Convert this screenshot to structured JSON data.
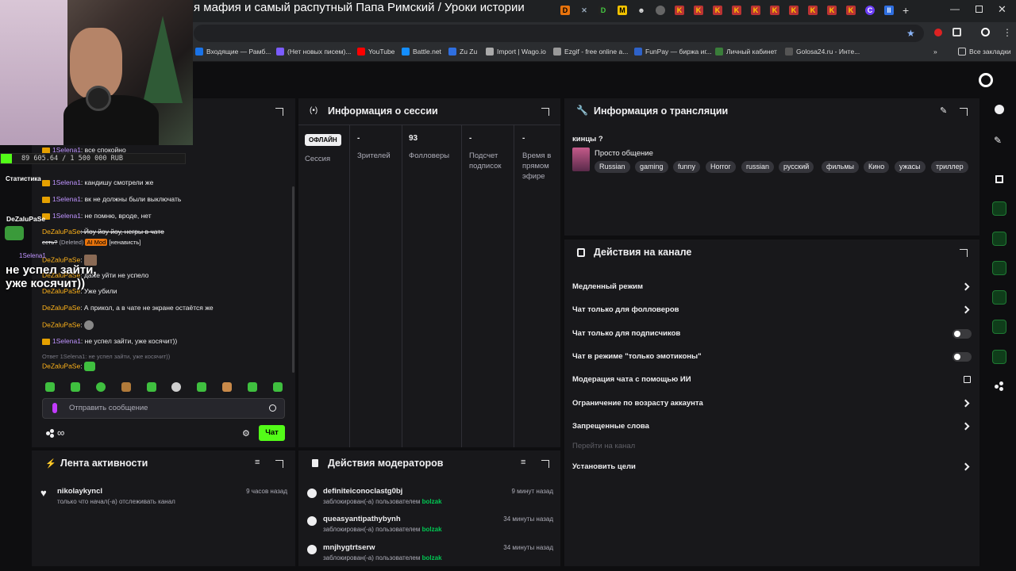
{
  "browser": {
    "tab_title": "я мафия и самый распутный Папа Римский / Уроки истории",
    "bookmarks": [
      "Входящие — Рамб...",
      "(Нет новых писем)...",
      "YouTube",
      "Battle.net",
      "Zu Zu",
      "Import | Wago.io",
      "Ezgif - free online a...",
      "FunPay — биржа иг...",
      "Личный кабинет",
      "Golosa24.ru - Инте..."
    ],
    "all_bookmarks": "Все закладки",
    "more": "»"
  },
  "overlay": {
    "donation": "89 605.64 / 1 500 000 RUB",
    "stats_label": "Статистика",
    "overlay_user": "DeZaluPaSe",
    "overlay_user2": "1Selena1",
    "overlay_msg": "не успел зайти, уже косячит))"
  },
  "chat": {
    "lines": [
      {
        "user": "1Selena1",
        "text": ": все спокойно",
        "cls": "u1"
      },
      {
        "user": "1Selena1",
        "text": ": кандишу смотрели же",
        "cls": "u1"
      },
      {
        "user": "1Selena1",
        "text": ": вк не должны были выключать",
        "cls": "u1"
      },
      {
        "user": "1Selena1",
        "text": ": не помню, вроде, нет",
        "cls": "u1"
      }
    ],
    "deleted_user": "DeZaluPaSe",
    "deleted_text": ": Йоу йоу йоу, негры в чате",
    "deleted_text2": "есть?",
    "deleted_tag": "(Deleted)",
    "ai_mod": "AI Mod",
    "ai_reason": "[ненависть]",
    "lines2": [
      {
        "user": "DeZaluPaSe",
        "text": ":"
      },
      {
        "user": "DeZaluPaSe",
        "text": ": даже уйти не успело"
      },
      {
        "user": "DeZaluPaSe",
        "text": ": Уже убили"
      },
      {
        "user": "DeZaluPaSe",
        "text": ": А прикол, а в чате не экране остаётся же"
      },
      {
        "user": "DeZaluPaSe",
        "text": ":"
      }
    ],
    "last_user": "1Selena1",
    "last_text": ": не успел зайти, уже косячит))",
    "reply_hint": "Ответ 1Selena1: не успел зайти, уже косячит))",
    "reply_user": "DeZaluPaSe",
    "reply_text": ":",
    "input_placeholder": "Отправить сообщение",
    "send_label": "Чат",
    "points": "∞"
  },
  "session": {
    "title": "Информация о сессии",
    "status_badge": "ОФЛАЙН",
    "session_label": "Сессия",
    "viewers_value": "-",
    "viewers_label": "Зрителей",
    "followers_value": "93",
    "followers_label": "Фолловеры",
    "subs_value": "-",
    "subs_label": "Подсчет подписок",
    "live_value": "-",
    "live_label": "Время в прямом эфире"
  },
  "stream_info": {
    "title": "Информация о трансляции",
    "stream_title": "кинцы ?",
    "category": "Просто общение",
    "tags": [
      "Russian",
      "gaming",
      "funny",
      "Horror",
      "russian",
      "русский",
      "фильмы",
      "Кино",
      "ужасы",
      "триллер"
    ]
  },
  "channel_actions": {
    "title": "Действия на канале",
    "items": [
      "Медленный режим",
      "Чат только для фолловеров",
      "Чат только для подписчиков",
      "Чат в режиме \"только эмотиконы\"",
      "Модерация чата с помощью ИИ",
      "Ограничение по возрасту аккаунта",
      "Запрещенные слова",
      "Перейти на канал",
      "Установить цели"
    ]
  },
  "activity": {
    "title": "Лента активности",
    "items": [
      {
        "user": "nikolaykyncl",
        "text": "только что начал(-а) отслеживать канал",
        "time": "9 часов назад"
      }
    ]
  },
  "mod_actions": {
    "title": "Действия модераторов",
    "items": [
      {
        "user": "definiteiconoclastg0bj",
        "text": "заблокирован(-а) пользователем",
        "by": "bolzak",
        "time": "9 минут назад"
      },
      {
        "user": "queasyantipathybynh",
        "text": "заблокирован(-а) пользователем",
        "by": "bolzak",
        "time": "34 минуты назад"
      },
      {
        "user": "mnjhygtrtserw",
        "text": "заблокирован(-а) пользователем",
        "by": "bolzak",
        "time": "34 минуты назад"
      }
    ]
  },
  "colors": {
    "accent": "#53fc18",
    "panel": "#18181b",
    "bg": "#0e0e10",
    "badge_bg": "#efeff1"
  }
}
